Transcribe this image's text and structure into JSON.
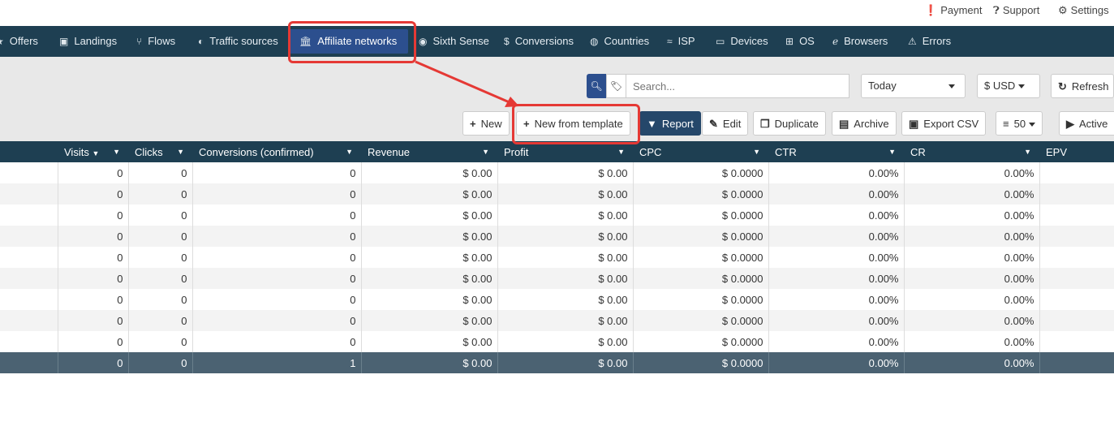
{
  "toplinks": {
    "payment": "Payment",
    "support": "Support",
    "settings": "Settings"
  },
  "nav": {
    "offers": "Offers",
    "landings": "Landings",
    "flows": "Flows",
    "traffic_sources": "Traffic sources",
    "affiliate_networks": "Affiliate networks",
    "sixth_sense": "Sixth Sense",
    "conversions": "Conversions",
    "countries": "Countries",
    "isp": "ISP",
    "devices": "Devices",
    "os": "OS",
    "browsers": "Browsers",
    "errors": "Errors"
  },
  "toolbar": {
    "search_placeholder": "Search...",
    "date_range": "Today",
    "currency": "$ USD",
    "refresh": "Refresh",
    "new": "New",
    "new_from_template": "New from template",
    "report": "Report",
    "edit": "Edit",
    "duplicate": "Duplicate",
    "archive": "Archive",
    "export_csv": "Export CSV",
    "page_size": "50",
    "status": "Active"
  },
  "table": {
    "headers": [
      "Visits",
      "Clicks",
      "Conversions (confirmed)",
      "Revenue",
      "Profit",
      "CPC",
      "CTR",
      "CR",
      "EPV"
    ],
    "rows": [
      [
        "0",
        "0",
        "0",
        "$ 0.00",
        "$ 0.00",
        "$ 0.0000",
        "0.00%",
        "0.00%",
        ""
      ],
      [
        "0",
        "0",
        "0",
        "$ 0.00",
        "$ 0.00",
        "$ 0.0000",
        "0.00%",
        "0.00%",
        ""
      ],
      [
        "0",
        "0",
        "0",
        "$ 0.00",
        "$ 0.00",
        "$ 0.0000",
        "0.00%",
        "0.00%",
        ""
      ],
      [
        "0",
        "0",
        "0",
        "$ 0.00",
        "$ 0.00",
        "$ 0.0000",
        "0.00%",
        "0.00%",
        ""
      ],
      [
        "0",
        "0",
        "0",
        "$ 0.00",
        "$ 0.00",
        "$ 0.0000",
        "0.00%",
        "0.00%",
        ""
      ],
      [
        "0",
        "0",
        "0",
        "$ 0.00",
        "$ 0.00",
        "$ 0.0000",
        "0.00%",
        "0.00%",
        ""
      ],
      [
        "0",
        "0",
        "0",
        "$ 0.00",
        "$ 0.00",
        "$ 0.0000",
        "0.00%",
        "0.00%",
        ""
      ],
      [
        "0",
        "0",
        "0",
        "$ 0.00",
        "$ 0.00",
        "$ 0.0000",
        "0.00%",
        "0.00%",
        ""
      ],
      [
        "0",
        "0",
        "0",
        "$ 0.00",
        "$ 0.00",
        "$ 0.0000",
        "0.00%",
        "0.00%",
        ""
      ]
    ],
    "total": [
      "0",
      "0",
      "1",
      "$ 0.00",
      "$ 0.00",
      "$ 0.0000",
      "0.00%",
      "0.00%",
      ""
    ]
  },
  "colors": {
    "nav_bg": "#1e3f52",
    "active_tab": "#2c4f8e",
    "highlight": "#e53935"
  }
}
